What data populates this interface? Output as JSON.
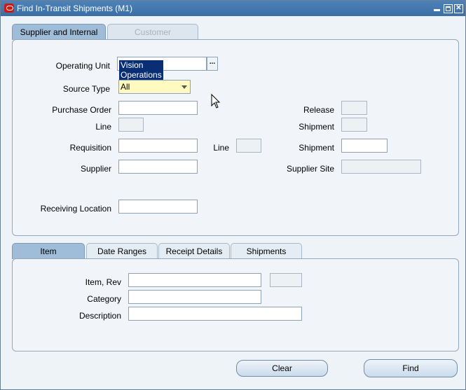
{
  "window": {
    "title": "Find In-Transit Shipments (M1)"
  },
  "top_tabs": [
    {
      "label": "Supplier and Internal"
    },
    {
      "label": "Customer"
    }
  ],
  "form": {
    "operating_unit_label": "Operating Unit",
    "operating_unit_value": "Vision Operations",
    "lov_label": "...",
    "source_type_label": "Source Type",
    "source_type_value": "All",
    "purchase_order_label": "Purchase Order",
    "release_label": "Release",
    "line_label": "Line",
    "shipment_label": "Shipment",
    "requisition_label": "Requisition",
    "req_line_label": "Line",
    "req_shipment_label": "Shipment",
    "supplier_label": "Supplier",
    "supplier_site_label": "Supplier Site",
    "receiving_location_label": "Receiving Location"
  },
  "bottom_tabs": [
    {
      "label": "Item"
    },
    {
      "label": "Date Ranges"
    },
    {
      "label": "Receipt Details"
    },
    {
      "label": "Shipments"
    }
  ],
  "item": {
    "item_rev_label": "Item, Rev",
    "category_label": "Category",
    "description_label": "Description"
  },
  "buttons": {
    "clear": "Clear",
    "find": "Find"
  },
  "colors": {
    "title_bar": "#3b6ea5",
    "active_tab": "#9fbcd8",
    "selected_field": "#fffac0",
    "highlight": "#0a2e73"
  }
}
